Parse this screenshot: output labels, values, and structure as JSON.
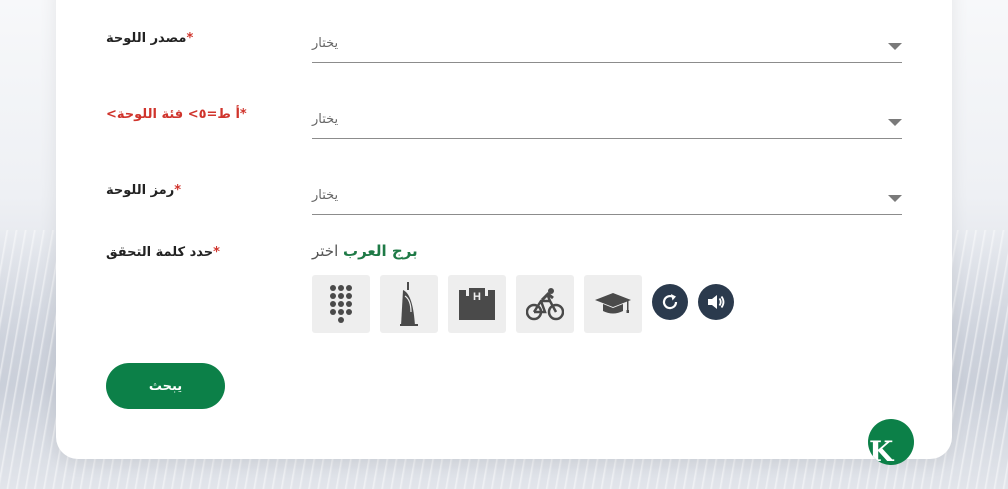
{
  "form": {
    "fields": [
      {
        "label": "مصدر اللوحة",
        "required_mark": "*",
        "placeholder": "يختار"
      },
      {
        "label": "أ ط=٥> فئة اللوحة>",
        "required_mark": "*",
        "placeholder": "يختار"
      },
      {
        "label": "رمز اللوحة",
        "required_mark": "*",
        "placeholder": "يختار"
      }
    ],
    "captcha": {
      "label": "حدد كلمة التحقق",
      "required_mark": "*",
      "prompt_prefix": "اختر",
      "prompt_target": "برج العرب",
      "options": [
        {
          "icon": "keypad-icon"
        },
        {
          "icon": "burj-al-arab-icon"
        },
        {
          "icon": "hospital-building-icon"
        },
        {
          "icon": "bicycle-icon"
        },
        {
          "icon": "graduation-cap-icon"
        }
      ],
      "refresh_icon": "refresh-icon",
      "audio_icon": "speaker-icon"
    },
    "submit_label": "يبحث"
  },
  "fab": {
    "letter": "K"
  },
  "colors": {
    "primary_green": "#0c8048",
    "required_red": "#d0342c",
    "dark_button": "#2b3a4d"
  }
}
